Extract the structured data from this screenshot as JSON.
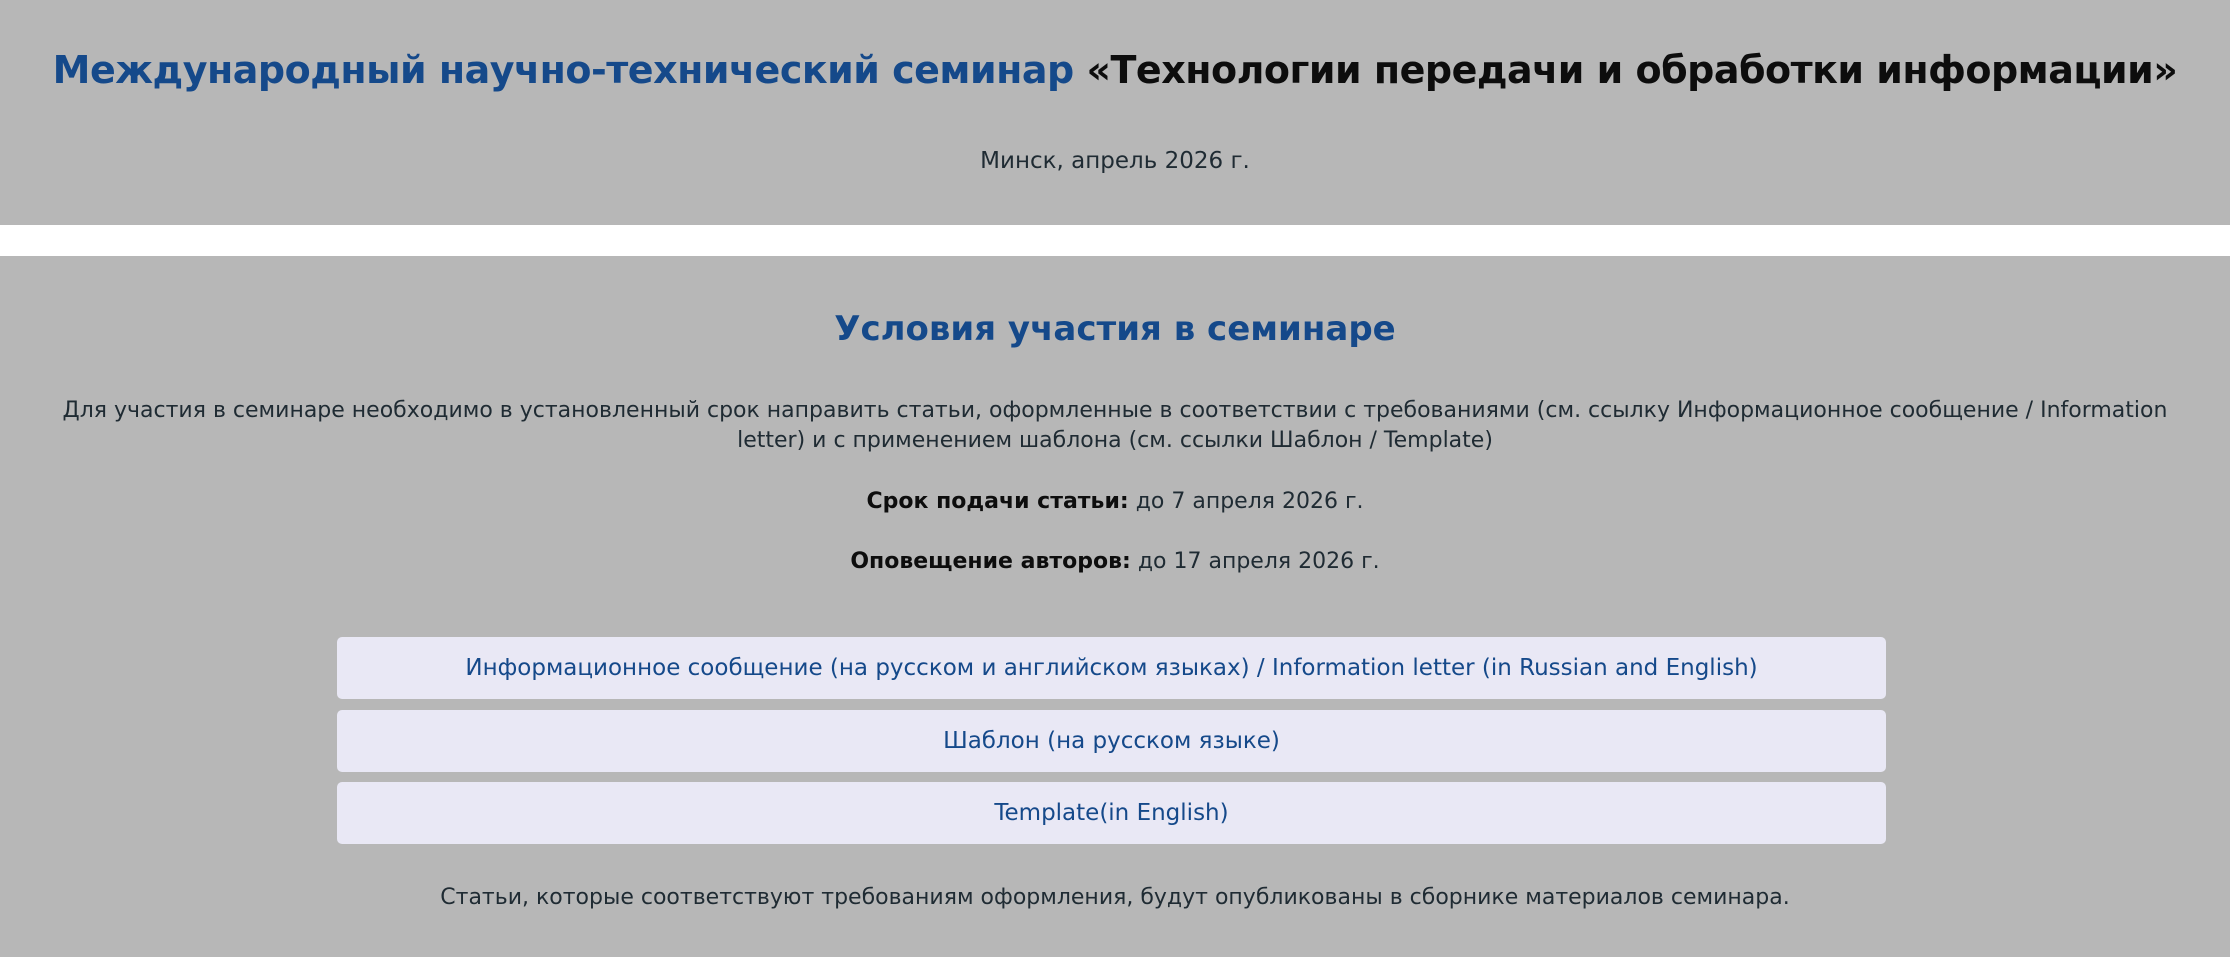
{
  "header": {
    "title_blue": "Международный научно-технический семинар",
    "title_black": "«Технологии передачи и обработки информации»",
    "subtitle": "Минск, апрель 2026 г."
  },
  "conditions": {
    "title": "Условия участия в семинаре",
    "intro": "Для участия в семинаре необходимо в установленный срок направить статьи, оформленные в соответствии с требованиями (см. ссылку Информационное сообщение / Information letter) и с применением шаблона (см. ссылки Шаблон / Template)",
    "deadline_label": "Срок подачи статьи:",
    "deadline_value": "до 7 апреля 2026 г.",
    "notify_label": "Оповещение авторов:",
    "notify_value": "до 17 апреля 2026 г.",
    "links": [
      "Информационное сообщение (на русском и английском языках) / Information letter (in Russian and English)",
      "Шаблон (на русском языке)",
      "Template(in English)"
    ],
    "footer_note": "Статьи, которые соответствуют требованиям оформления, будут опубликованы в сборнике материалов семинара."
  },
  "colors": {
    "panel_background": "#b7b7b7",
    "accent_blue": "#15498a",
    "link_button_background": "#e9e8f5"
  }
}
